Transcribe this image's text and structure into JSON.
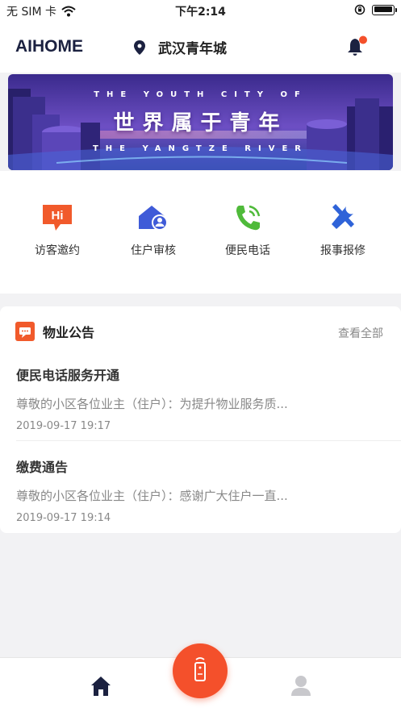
{
  "status_bar": {
    "carrier": "无 SIM 卡",
    "time": "下午2:14"
  },
  "header": {
    "logo": "AIHOME",
    "location": "武汉青年城",
    "has_notification": true
  },
  "banner": {
    "subtitle_top": "THE YOUTH CITY OF",
    "title": "世界属于青年",
    "subtitle_bottom": "THE YANGTZE RIVER"
  },
  "quick_actions": [
    {
      "label": "访客邀约",
      "icon": "hi-chat-icon",
      "color": "#f15a2b"
    },
    {
      "label": "住户审核",
      "icon": "house-user-icon",
      "color": "#3f5bd8"
    },
    {
      "label": "便民电话",
      "icon": "phone-icon",
      "color": "#4fba3a"
    },
    {
      "label": "报事报修",
      "icon": "repair-tools-icon",
      "color": "#2f63d8"
    }
  ],
  "notice": {
    "title": "物业公告",
    "view_all": "查看全部",
    "items": [
      {
        "title": "便民电话服务开通",
        "summary": "尊敬的小区各位业主（住户）：为提升物业服务质...",
        "date": "2019-09-17 19:17"
      },
      {
        "title": "缴费通告",
        "summary": "尊敬的小区各位业主（住户）：感谢广大住户一直...",
        "date": "2019-09-17 19:14"
      }
    ]
  },
  "tabbar": {
    "active": "home"
  },
  "colors": {
    "accent": "#f4502b",
    "navy": "#1b2140",
    "background": "#f2f2f4"
  }
}
